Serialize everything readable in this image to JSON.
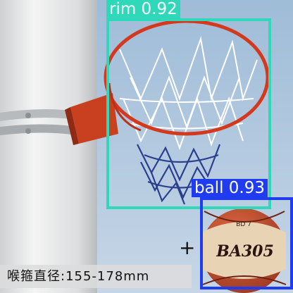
{
  "detections": [
    {
      "label": "rim 0.92",
      "class": "rim",
      "score": 0.92,
      "color": "#2fd8b8"
    },
    {
      "label": "ball 0.93",
      "class": "ball",
      "score": 0.93,
      "color": "#1f3cf0"
    }
  ],
  "caption": "喉箍直径:155-178mm",
  "plus_mark": "+",
  "ball_print": "BD 7",
  "ball_logo": "BA305",
  "colors": {
    "sky": "#b9cde0",
    "pole": "#e6e7e7",
    "rim": "#d4391d",
    "net_white": "#ffffff",
    "net_blue": "#2a3f8f",
    "ball": "#c9502f",
    "ball_panel": "#e9d3b5"
  }
}
